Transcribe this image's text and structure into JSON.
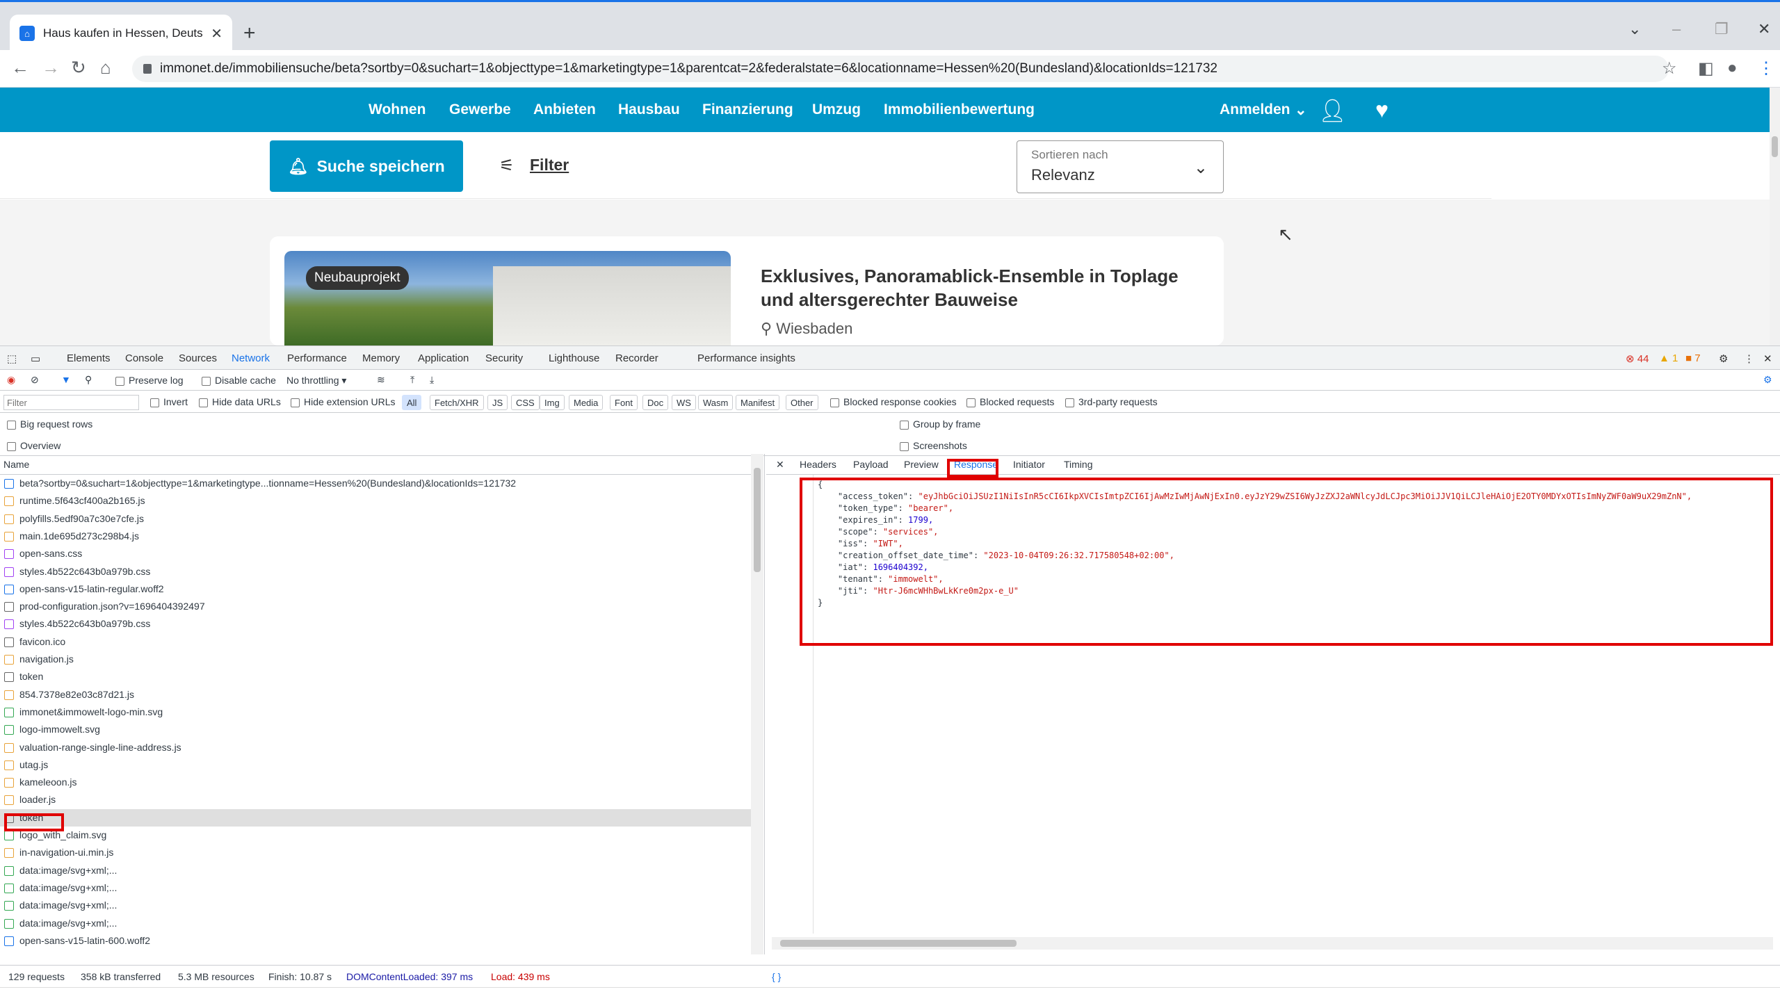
{
  "browser": {
    "tab_title": "Haus kaufen in Hessen, Deutsch",
    "url": "immonet.de/immobiliensuche/beta?sortby=0&suchart=1&objecttype=1&marketingtype=1&parentcat=2&federalstate=6&locationname=Hessen%20(Bundesland)&locationIds=121732"
  },
  "site": {
    "nav": [
      "Wohnen",
      "Gewerbe",
      "Anbieten",
      "Hausbau",
      "Finanzierung",
      "Umzug",
      "Immobilienbewertung"
    ],
    "login": "Anmelden",
    "save_search": "Suche speichern",
    "filter": "Filter",
    "sort_label": "Sortieren nach",
    "sort_value": "Relevanz",
    "card": {
      "badge": "Neubauprojekt",
      "title": "Exklusives, Panoramablick-Ensemble in Toplage und altersgerechter Bauweise",
      "location": "Wiesbaden"
    },
    "brand_color": "#0096c7"
  },
  "devtools": {
    "tabs": [
      "Elements",
      "Console",
      "Sources",
      "Network",
      "Performance",
      "Memory",
      "Application",
      "Security",
      "Lighthouse",
      "Recorder",
      "Performance insights"
    ],
    "active_tab": "Network",
    "counts": {
      "errors": "44",
      "warnings": "1",
      "issues": "7"
    },
    "toolbar": {
      "preserve_log": "Preserve log",
      "disable_cache": "Disable cache",
      "throttling": "No throttling"
    },
    "filterbar": {
      "placeholder": "Filter",
      "invert": "Invert",
      "hide_data_urls": "Hide data URLs",
      "hide_extension_urls": "Hide extension URLs",
      "types": [
        "All",
        "Fetch/XHR",
        "JS",
        "CSS",
        "Img",
        "Media",
        "Font",
        "Doc",
        "WS",
        "Wasm",
        "Manifest",
        "Other"
      ],
      "blocked_cookies": "Blocked response cookies",
      "blocked_requests": "Blocked requests",
      "third_party": "3rd-party requests"
    },
    "options": {
      "big_rows": "Big request rows",
      "overview": "Overview",
      "group_by_frame": "Group by frame",
      "screenshots": "Screenshots"
    },
    "name_header": "Name",
    "requests": [
      {
        "name": "beta?sortby=0&suchart=1&objecttype=1&marketingtype...tionname=Hessen%20(Bundesland)&locationIds=121732",
        "kind": "doc"
      },
      {
        "name": "runtime.5f643cf400a2b165.js",
        "kind": "js"
      },
      {
        "name": "polyfills.5edf90a7c30e7cfe.js",
        "kind": "js"
      },
      {
        "name": "main.1de695d273c298b4.js",
        "kind": "js"
      },
      {
        "name": "open-sans.css",
        "kind": "css"
      },
      {
        "name": "styles.4b522c643b0a979b.css",
        "kind": "css"
      },
      {
        "name": "open-sans-v15-latin-regular.woff2",
        "kind": "font"
      },
      {
        "name": "prod-configuration.json?v=1696404392497",
        "kind": "other"
      },
      {
        "name": "styles.4b522c643b0a979b.css",
        "kind": "css"
      },
      {
        "name": "favicon.ico",
        "kind": "other"
      },
      {
        "name": "navigation.js",
        "kind": "js"
      },
      {
        "name": "token",
        "kind": "other"
      },
      {
        "name": "854.7378e82e03c87d21.js",
        "kind": "js"
      },
      {
        "name": "immonet&immowelt-logo-min.svg",
        "kind": "img"
      },
      {
        "name": "logo-immowelt.svg",
        "kind": "img"
      },
      {
        "name": "valuation-range-single-line-address.js",
        "kind": "js"
      },
      {
        "name": "utag.js",
        "kind": "js"
      },
      {
        "name": "kameleoon.js",
        "kind": "js"
      },
      {
        "name": "loader.js",
        "kind": "js"
      },
      {
        "name": "token",
        "kind": "other"
      },
      {
        "name": "logo_with_claim.svg",
        "kind": "img"
      },
      {
        "name": "in-navigation-ui.min.js",
        "kind": "js"
      },
      {
        "name": "data:image/svg+xml;...",
        "kind": "img"
      },
      {
        "name": "data:image/svg+xml;...",
        "kind": "img"
      },
      {
        "name": "data:image/svg+xml;...",
        "kind": "img"
      },
      {
        "name": "data:image/svg+xml;...",
        "kind": "img"
      },
      {
        "name": "open-sans-v15-latin-600.woff2",
        "kind": "font"
      }
    ],
    "detail_tabs": [
      "Headers",
      "Payload",
      "Preview",
      "Response",
      "Initiator",
      "Timing"
    ],
    "active_detail_tab": "Response",
    "response": {
      "access_token": "eyJhbGciOiJSUzI1NiIsInR5cCI6IkpXVCIsImtpZCI6IjAwMzIwMjAwNjExIn0.eyJzY29wZSI6WyJzZXJ2aWNlcyJdLCJpc3MiOiJJV1QiLCJleHAiOjE2OTY0MDYxOTIsImNyZWF0aW9uX29mZnN",
      "token_type": "bearer",
      "expires_in": "1799",
      "scope": "services",
      "iss": "IWT",
      "creation_offset_date_time": "2023-10-04T09:26:32.717580548+02:00",
      "iat": "1696404392",
      "tenant": "immowelt",
      "jti": "Htr-J6mcWHhBwLkKre0m2px-e_U"
    },
    "status": {
      "requests": "129 requests",
      "transferred": "358 kB transferred",
      "resources": "5.3 MB resources",
      "finish": "Finish: 10.87 s",
      "dcl": "DOMContentLoaded: 397 ms",
      "load": "Load: 439 ms"
    }
  }
}
